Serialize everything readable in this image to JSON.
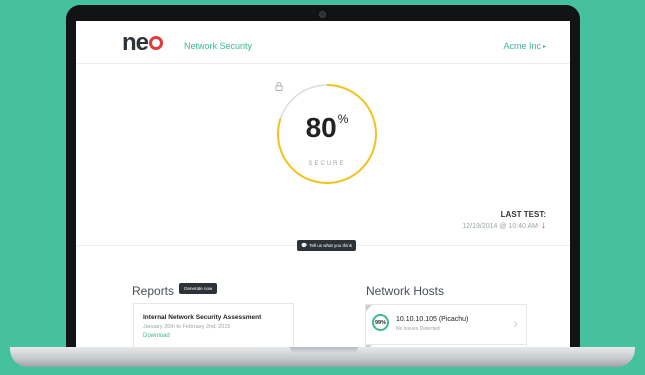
{
  "header": {
    "logo_text": "ne",
    "nav_title": "Network Security",
    "org_name": "Acme Inc",
    "org_caret": "▸"
  },
  "score": {
    "value": "80",
    "unit": "%",
    "label": "SECURE",
    "fraction": 0.8,
    "ring_color": "#f2c318",
    "track_color": "#d9dcdf"
  },
  "last_test": {
    "label": "LAST TEST:",
    "datetime": "12/19/2014 @ 10:40 AM",
    "trend_icon": "arrow-down-icon",
    "trend_color": "#e2402e"
  },
  "feedback": {
    "icon": "chat-icon",
    "label": "Tell us what you think"
  },
  "reports": {
    "title": "Reports",
    "generate_label": "Generate now",
    "items": [
      {
        "name": "Internal Network Security Assessment",
        "dates": "January 26th to February 2nd, 2015",
        "download_label": "Download"
      }
    ]
  },
  "hosts": {
    "title": "Network Hosts",
    "items": [
      {
        "score": "99%",
        "ip": "10.10.10.105 (Picachu)",
        "status": "No Issues Detected"
      }
    ]
  },
  "colors": {
    "background": "#46c1a0",
    "accent": "#3fb896",
    "logo_red": "#e23b3b",
    "dark_button": "#2c3238"
  }
}
